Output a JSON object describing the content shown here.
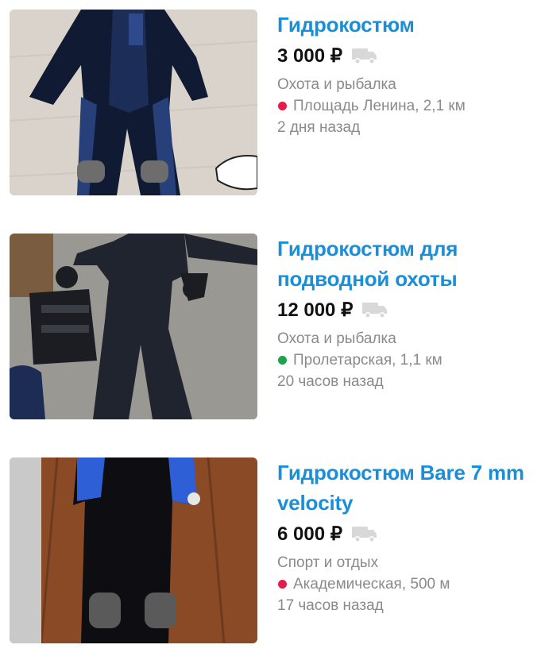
{
  "listings": [
    {
      "title": "Гидрокостюм",
      "price": "3 000 ₽",
      "category": "Охота и рыбалка",
      "location": "Площадь Ленина, 2,1 км",
      "location_color": "#e8194b",
      "time": "2 дня назад"
    },
    {
      "title": "Гидрокостюм для подводной охоты",
      "price": "12 000 ₽",
      "category": "Охота и рыбалка",
      "location": "Пролетарская, 1,1 км",
      "location_color": "#1ea24b",
      "time": "20 часов назад"
    },
    {
      "title": "Гидрокостюм Bare 7 mm velocity",
      "price": "6 000 ₽",
      "category": "Спорт и отдых",
      "location": "Академическая, 500 м",
      "location_color": "#e8194b",
      "time": "17 часов назад"
    }
  ],
  "icons": {
    "delivery": "truck-icon",
    "metro": "dot-icon"
  },
  "colors": {
    "title": "#1a8fd8",
    "price": "#111111",
    "meta": "#8a8a8a"
  }
}
